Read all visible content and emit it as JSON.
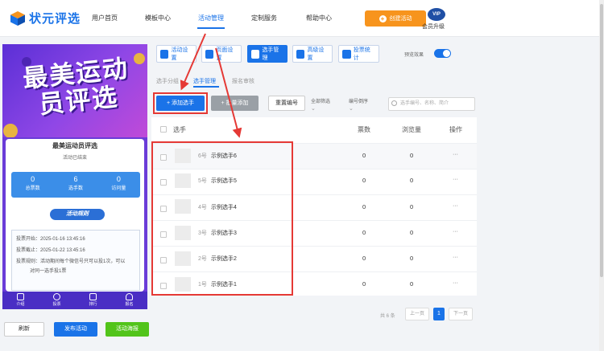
{
  "header": {
    "brand": "状元评选",
    "nav": [
      "用户首页",
      "模板中心",
      "活动管理",
      "定制服务",
      "帮助中心"
    ],
    "create_label": "创建活动",
    "vip_badge": "VIP",
    "vip_label": "会员升级"
  },
  "preview": {
    "banner_title": "最美运动员评选",
    "card_title": "最美运动员评选",
    "card_status": "活动已结束",
    "stats": [
      {
        "value": "0",
        "label": "总票数"
      },
      {
        "value": "6",
        "label": "选手数"
      },
      {
        "value": "0",
        "label": "访问量"
      }
    ],
    "rule_button": "活动规则",
    "rules": [
      "投票开始：2025-01-16 13:45:16",
      "投票截止：2025-01-22 13:45:16",
      "投票规则：活动期间每个微信号只可以投1次，可以",
      "对同一选手投1票"
    ],
    "tabbar": [
      "介绍",
      "投票",
      "排行",
      "报名"
    ]
  },
  "bottom_actions": {
    "refresh": "刷新",
    "publish": "发布活动",
    "poster": "活动海报"
  },
  "toolbar": {
    "buttons": [
      "活动设置",
      "页面设置",
      "选手管理",
      "高级设置",
      "投票统计"
    ],
    "preview_label": "预览效果"
  },
  "subtabs": [
    "选手分组",
    "选手管理",
    "报名审核"
  ],
  "actions": {
    "add": "+ 添加选手",
    "batch": "+ 批量添加",
    "renumber": "重置编号",
    "filter_all": "全部筛选",
    "sort": "编号倒序",
    "search_placeholder": "选手编号、名称、简介"
  },
  "table": {
    "headers": [
      "选手",
      "票数",
      "浏览量",
      "操作"
    ],
    "rows": [
      {
        "num": "6号",
        "name": "示例选手6",
        "votes": "0",
        "views": "0",
        "op": "···"
      },
      {
        "num": "5号",
        "name": "示例选手5",
        "votes": "0",
        "views": "0",
        "op": "···"
      },
      {
        "num": "4号",
        "name": "示例选手4",
        "votes": "0",
        "views": "0",
        "op": "···"
      },
      {
        "num": "3号",
        "name": "示例选手3",
        "votes": "0",
        "views": "0",
        "op": "···"
      },
      {
        "num": "2号",
        "name": "示例选手2",
        "votes": "0",
        "views": "0",
        "op": "···"
      },
      {
        "num": "1号",
        "name": "示例选手1",
        "votes": "0",
        "views": "0",
        "op": "···"
      }
    ]
  },
  "pager": {
    "total": "共 6 条",
    "prev": "上一页",
    "current": "1",
    "next": "下一页"
  },
  "colors": {
    "accent": "#1a73e8",
    "orange": "#f7941d",
    "green": "#52c41a",
    "annotation": "#e53935"
  }
}
